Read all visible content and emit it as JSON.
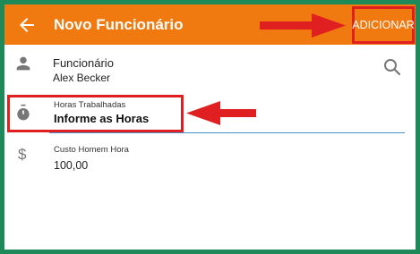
{
  "appbar": {
    "title": "Novo Funcionário",
    "add_label": "ADICIONAR",
    "bg_color": "#f07a10",
    "back_icon": "arrow-left-icon"
  },
  "employee": {
    "label": "Funcionário",
    "value": "Alex Becker",
    "icon": "person-icon",
    "search_icon": "search-icon"
  },
  "hours": {
    "label": "Horas Trabalhadas",
    "placeholder": "Informe as Horas",
    "icon": "stopwatch-icon"
  },
  "cost": {
    "label": "Custo Homem Hora",
    "value": "100,00",
    "icon": "dollar-icon"
  },
  "colors": {
    "frame": "#1e8a5a",
    "highlight": "#e02020",
    "underline": "#4a90c8"
  }
}
